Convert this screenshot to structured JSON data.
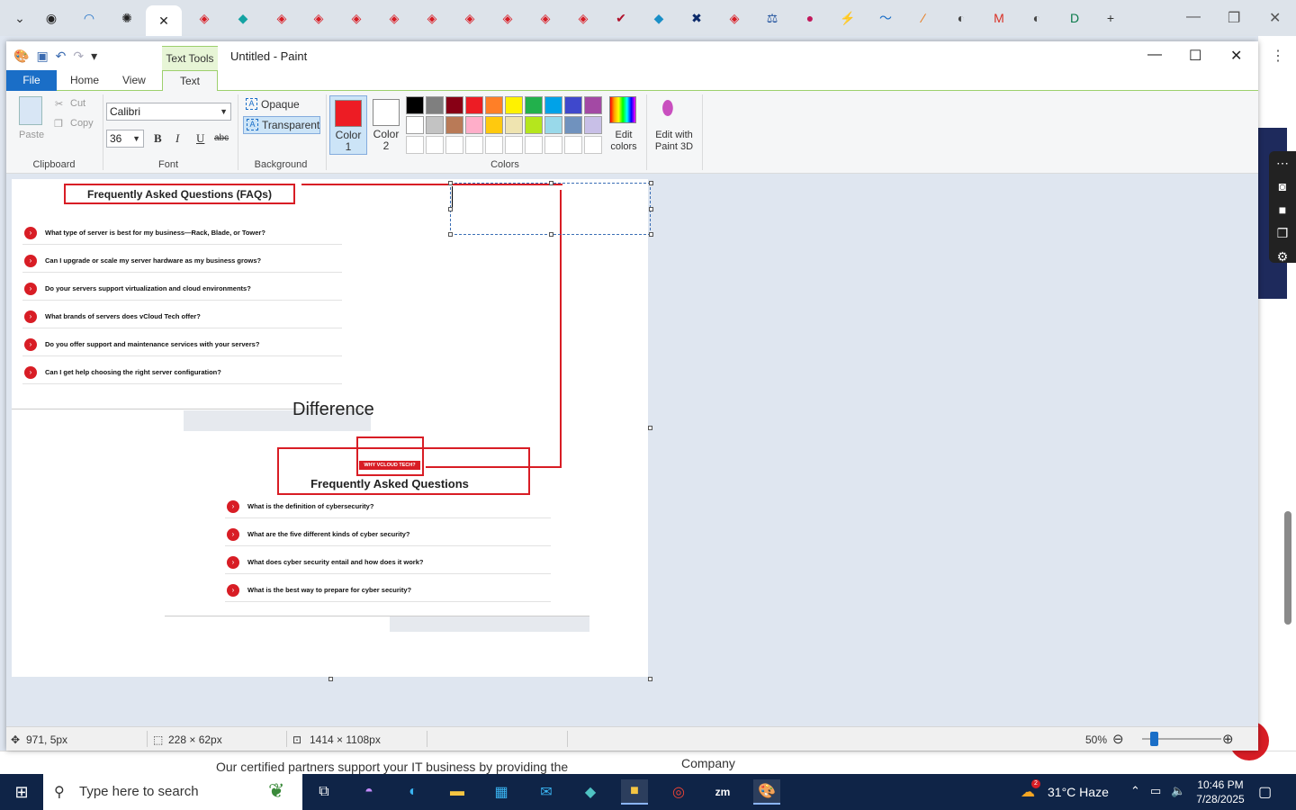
{
  "browser": {
    "tabs": [
      {
        "icon": "chevron-down-icon",
        "glyph": "⌄",
        "color": "#333333"
      },
      {
        "icon": "tab-site-icon",
        "glyph": "◉",
        "color": "#222222"
      },
      {
        "icon": "tab-site-icon",
        "glyph": "◠",
        "color": "#1a6ec7"
      },
      {
        "icon": "tab-openai-icon",
        "glyph": "✺",
        "color": "#222222"
      },
      {
        "icon": "close-icon",
        "glyph": "✕",
        "color": "#222222",
        "active": true
      },
      {
        "icon": "tab-site-icon",
        "glyph": "◈",
        "color": "#d81d25"
      },
      {
        "icon": "tab-site-icon",
        "glyph": "◆",
        "color": "#14a3a3"
      },
      {
        "icon": "tab-site-icon",
        "glyph": "◈",
        "color": "#d81d25"
      },
      {
        "icon": "tab-site-icon",
        "glyph": "◈",
        "color": "#d81d25"
      },
      {
        "icon": "tab-site-icon",
        "glyph": "◈",
        "color": "#d81d25"
      },
      {
        "icon": "tab-site-icon",
        "glyph": "◈",
        "color": "#d81d25"
      },
      {
        "icon": "tab-site-icon",
        "glyph": "◈",
        "color": "#d81d25"
      },
      {
        "icon": "tab-site-icon",
        "glyph": "◈",
        "color": "#d81d25"
      },
      {
        "icon": "tab-site-icon",
        "glyph": "◈",
        "color": "#d81d25"
      },
      {
        "icon": "tab-site-icon",
        "glyph": "◈",
        "color": "#d81d25"
      },
      {
        "icon": "tab-site-icon",
        "glyph": "◈",
        "color": "#d81d25"
      },
      {
        "icon": "tab-site-icon",
        "glyph": "✔",
        "color": "#b0102a"
      },
      {
        "icon": "tab-site-icon",
        "glyph": "◆",
        "color": "#1a8fc7"
      },
      {
        "icon": "tab-site-icon",
        "glyph": "✖",
        "color": "#0b2a6a"
      },
      {
        "icon": "tab-site-icon",
        "glyph": "◈",
        "color": "#d81d25"
      },
      {
        "icon": "tab-site-icon",
        "glyph": "⚖",
        "color": "#1a4d9a"
      },
      {
        "icon": "tab-site-icon",
        "glyph": "●",
        "color": "#c2185b"
      },
      {
        "icon": "tab-site-icon",
        "glyph": "⚡",
        "color": "#2a9d4a"
      },
      {
        "icon": "tab-site-icon",
        "glyph": "〜",
        "color": "#1a6ec7"
      },
      {
        "icon": "tab-site-icon",
        "glyph": "∕",
        "color": "#e8710a"
      },
      {
        "icon": "tab-site-icon",
        "glyph": "◐",
        "color": "#444444"
      },
      {
        "icon": "tab-gmail-icon",
        "glyph": "M",
        "color": "#d93025"
      },
      {
        "icon": "tab-site-icon",
        "glyph": "◐",
        "color": "#444444"
      },
      {
        "icon": "tab-site-icon",
        "glyph": "D",
        "color": "#0a7a4a"
      },
      {
        "icon": "new-tab-icon",
        "glyph": "+",
        "color": "#333333"
      }
    ]
  },
  "paint": {
    "window_title": "Untitled - Paint",
    "context_tab": "Text Tools",
    "tabs": {
      "file": "File",
      "home": "Home",
      "view": "View",
      "text": "Text"
    },
    "clipboard": {
      "paste": "Paste",
      "cut": "Cut",
      "copy": "Copy",
      "label": "Clipboard"
    },
    "font": {
      "family": "Calibri",
      "size": "36",
      "label": "Font",
      "bold": "B",
      "italic": "I",
      "underline": "U",
      "strike": "abc"
    },
    "background": {
      "opaque": "Opaque",
      "transparent": "Transparent",
      "label": "Background"
    },
    "colors": {
      "color1_label": "Color 1",
      "color2_label": "Color 2",
      "color1": "#ed1c24",
      "color2": "#ffffff",
      "label": "Colors",
      "edit_colors": "Edit colors",
      "paint3d": "Edit with Paint 3D",
      "palette_row1": [
        "#000000",
        "#7f7f7f",
        "#880015",
        "#ed1c24",
        "#ff7f27",
        "#fff200",
        "#22b14c",
        "#00a2e8",
        "#3f48cc",
        "#a349a4"
      ],
      "palette_row2": [
        "#ffffff",
        "#c3c3c3",
        "#b97a57",
        "#ffaec9",
        "#ffc90e",
        "#efe4b0",
        "#b5e61d",
        "#99d9ea",
        "#7092be",
        "#c8bfe7"
      ]
    },
    "canvas": {
      "faq1_title": "Frequently Asked Questions (FAQs)",
      "faq1_items": [
        "What type of server is best for my business—Rack, Blade, or Tower?",
        "Can I upgrade or scale my server hardware as my business grows?",
        "Do your servers support virtualization and cloud environments?",
        "What brands of servers does vCloud Tech offer?",
        "Do you offer support and maintenance services with your servers?",
        "Can I get help choosing the right server configuration?"
      ],
      "difference": "Difference",
      "why_badge": "WHY VCLOUD TECH?",
      "faq2_title": "Frequently Asked Questions",
      "faq2_items": [
        "What is the definition of cybersecurity?",
        "What are the five different kinds of cyber security?",
        "What does cyber security entail and how does it work?",
        "What is the best way to prepare for cyber security?"
      ]
    },
    "status": {
      "cursor": "971, 5px",
      "selection": "228 × 62px",
      "canvas_size": "1414 × 1108px",
      "zoom": "50%"
    }
  },
  "background_site": {
    "footer_text": "Our certified partners support your IT business by providing the",
    "footer_col": "Company"
  },
  "taskbar": {
    "search_placeholder": "Type here to search",
    "weather": "31°C  Haze",
    "weather_badge": "2",
    "time": "10:46 PM",
    "date": "7/28/2025"
  }
}
